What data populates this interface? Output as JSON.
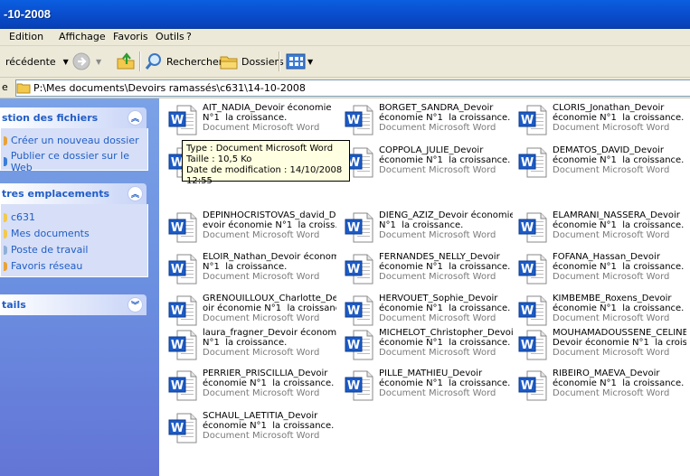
{
  "window": {
    "title": "-10-2008"
  },
  "menu": [
    "Edition",
    "Affichage",
    "Favoris",
    "Outils",
    "?"
  ],
  "toolbar": {
    "back": "récédente",
    "search": "Rechercher",
    "folders": "Dossiers"
  },
  "address": {
    "path": "P:\\Mes documents\\Devoirs ramassés\\c631\\14-10-2008"
  },
  "panels": {
    "tasks": {
      "title": "stion des fichiers",
      "items": [
        "Créer un nouveau dossier",
        "Publier ce dossier sur le Web"
      ]
    },
    "places": {
      "title": "tres emplacements",
      "items": [
        "c631",
        "Mes documents",
        "Poste de travail",
        "Favoris réseau"
      ]
    },
    "details": {
      "title": "tails"
    }
  },
  "tooltip": {
    "line1": "Type : Document Microsoft Word",
    "line2": "Taille : 10,5 Ko",
    "line3": "Date de modification : 14/10/2008 12:55"
  },
  "files": [
    {
      "l1": "AIT_NADIA_Devoir économie",
      "l2": "N°1  la croissance.",
      "type": "Document Microsoft Word"
    },
    {
      "l1": "BORGET_SANDRA_Devoir",
      "l2": "économie N°1  la croissance.",
      "type": "Document Microsoft Word"
    },
    {
      "l1": "CLORIS_Jonathan_Devoir",
      "l2": "économie N°1  la croissance.",
      "type": "Document Microsoft Word"
    },
    {
      "l1": "",
      "l2": "",
      "type": ""
    },
    {
      "l1": "COPPOLA_JULIE_Devoir",
      "l2": "économie N°1  la croissance.",
      "type": "Document Microsoft Word"
    },
    {
      "l1": "DEMATOS_DAVID_Devoir",
      "l2": "économie N°1  la croissance.",
      "type": "Document Microsoft Word"
    },
    {
      "l1": "DEPINHOCRISTOVAS_david_D",
      "l2": "evoir économie N°1  la croiss...",
      "type": "Document Microsoft Word"
    },
    {
      "l1": "DIENG_AZIZ_Devoir économie",
      "l2": "N°1  la croissance.",
      "type": "Document Microsoft Word"
    },
    {
      "l1": "ELAMRANI_NASSERA_Devoir",
      "l2": "économie N°1  la croissance.",
      "type": "Document Microsoft Word"
    },
    {
      "l1": "ELOIR_Nathan_Devoir économie",
      "l2": "N°1  la croissance.",
      "type": "Document Microsoft Word"
    },
    {
      "l1": "FERNANDES_NELLY_Devoir",
      "l2": "économie N°1  la croissance.",
      "type": "Document Microsoft Word"
    },
    {
      "l1": "FOFANA_Hassan_Devoir",
      "l2": "économie N°1  la croissance.",
      "type": "Document Microsoft Word"
    },
    {
      "l1": "GRENOUILLOUX_Charlotte_Dev",
      "l2": "oir économie N°1  la croissance.",
      "type": "Document Microsoft Word"
    },
    {
      "l1": "HERVOUET_Sophie_Devoir",
      "l2": "économie N°1  la croissance.",
      "type": "Document Microsoft Word"
    },
    {
      "l1": "KIMBEMBE_Roxens_Devoir",
      "l2": "économie N°1  la croissance.",
      "type": "Document Microsoft Word"
    },
    {
      "l1": "laura_fragner_Devoir économie",
      "l2": "N°1  la croissance.",
      "type": "Document Microsoft Word"
    },
    {
      "l1": "MICHELOT_Christopher_Devoir",
      "l2": "économie N°1  la croissance.",
      "type": "Document Microsoft Word"
    },
    {
      "l1": "MOUHAMADOUSSENE_CELINE_",
      "l2": "Devoir économie N°1  la croiss...",
      "type": "Document Microsoft Word"
    },
    {
      "l1": "PERRIER_PRISCILLIA_Devoir",
      "l2": "économie N°1  la croissance.",
      "type": "Document Microsoft Word"
    },
    {
      "l1": "PILLE_MATHIEU_Devoir",
      "l2": "économie N°1  la croissance.",
      "type": "Document Microsoft Word"
    },
    {
      "l1": "RIBEIRO_MAEVA_Devoir",
      "l2": "économie N°1  la croissance.",
      "type": "Document Microsoft Word"
    },
    {
      "l1": "SCHAUL_LAETITIA_Devoir",
      "l2": "économie N°1  la croissance.",
      "type": "Document Microsoft Word"
    }
  ]
}
